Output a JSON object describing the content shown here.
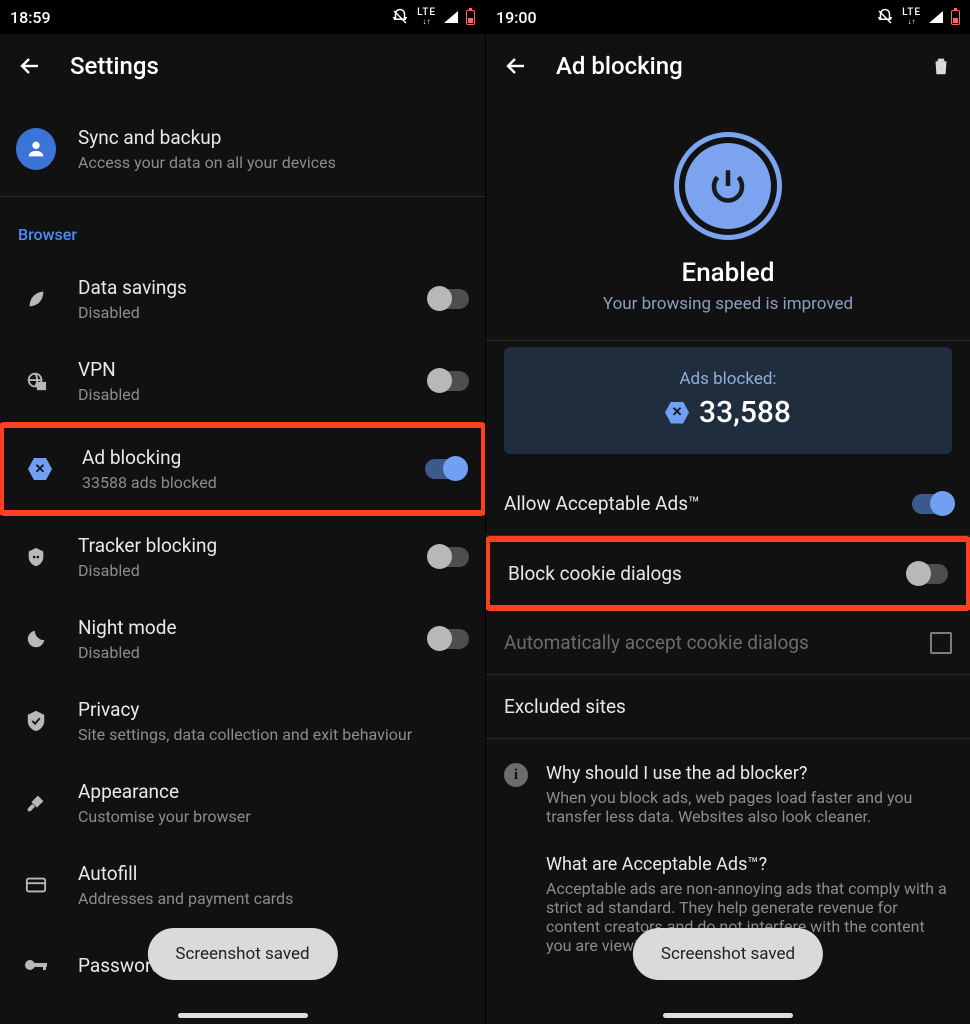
{
  "left": {
    "clock": "18:59",
    "title": "Settings",
    "sync": {
      "title": "Sync and backup",
      "subtitle": "Access your data on all your devices"
    },
    "section": "Browser",
    "items": [
      {
        "title": "Data savings",
        "subtitle": "Disabled",
        "toggle": "off"
      },
      {
        "title": "VPN",
        "subtitle": "Disabled",
        "toggle": "off"
      },
      {
        "title": "Ad blocking",
        "subtitle": "33588 ads blocked",
        "toggle": "on",
        "highlight": true
      },
      {
        "title": "Tracker blocking",
        "subtitle": "Disabled",
        "toggle": "off"
      },
      {
        "title": "Night mode",
        "subtitle": "Disabled",
        "toggle": "off"
      },
      {
        "title": "Privacy",
        "subtitle": "Site settings, data collection and exit behaviour"
      },
      {
        "title": "Appearance",
        "subtitle": "Customise your browser"
      },
      {
        "title": "Autofill",
        "subtitle": "Addresses and payment cards"
      },
      {
        "title": "Passwords",
        "subtitle": ""
      }
    ],
    "toast": "Screenshot saved"
  },
  "right": {
    "clock": "19:00",
    "title": "Ad blocking",
    "enabled_title": "Enabled",
    "enabled_sub": "Your browsing speed is improved",
    "stats_label": "Ads blocked:",
    "stats_value": "33,588",
    "opt_allow": "Allow Acceptable Ads™",
    "opt_cookie": "Block cookie dialogs",
    "opt_auto": "Automatically accept cookie dialogs",
    "opt_excluded": "Excluded sites",
    "info1_title": "Why should I use the ad blocker?",
    "info1_body": "When you block ads, web pages load faster and you transfer less data. Websites also look cleaner.",
    "info2_title": "What are Acceptable Ads™?",
    "info2_body": "Acceptable ads are non-annoying ads that comply with a strict ad standard. They help generate revenue for content creators and do not interfere with the content you are viewing.",
    "toast": "Screenshot saved"
  }
}
